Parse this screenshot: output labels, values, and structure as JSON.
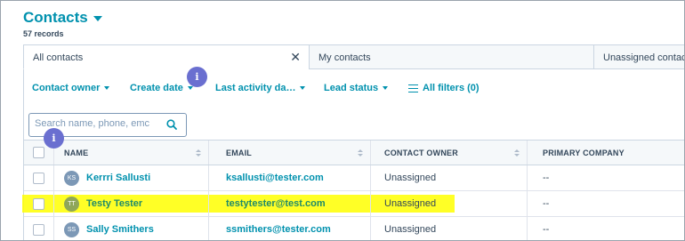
{
  "header": {
    "title": "Contacts",
    "records": "57 records"
  },
  "tabs": [
    {
      "label": "All contacts",
      "active": true
    },
    {
      "label": "My contacts",
      "active": false
    },
    {
      "label": "Unassigned contacts",
      "active": false
    }
  ],
  "filters": {
    "contact_owner": "Contact owner",
    "create_date": "Create date",
    "last_activity": "Last activity da…",
    "lead_status": "Lead status",
    "all_filters": "All filters (0)"
  },
  "search": {
    "placeholder": "Search name, phone, emc"
  },
  "info_badge": "i",
  "table": {
    "columns": {
      "name": "NAME",
      "email": "EMAIL",
      "owner": "CONTACT OWNER",
      "company": "PRIMARY COMPANY"
    },
    "rows": [
      {
        "initials": "KS",
        "name": "Kerrri Sallusti",
        "email": "ksallusti@tester.com",
        "owner": "Unassigned",
        "company": "--"
      },
      {
        "initials": "TT",
        "name": "Testy Tester",
        "email": "testytester@test.com",
        "owner": "Unassigned",
        "company": "--",
        "highlighted": true
      },
      {
        "initials": "SS",
        "name": "Sally Smithers",
        "email": "ssmithers@tester.com",
        "owner": "Unassigned",
        "company": "--"
      }
    ]
  },
  "colors": {
    "accent": "#0091ae",
    "text": "#33475b",
    "info_badge": "#6a6fd0",
    "highlight": "#ffff00"
  }
}
